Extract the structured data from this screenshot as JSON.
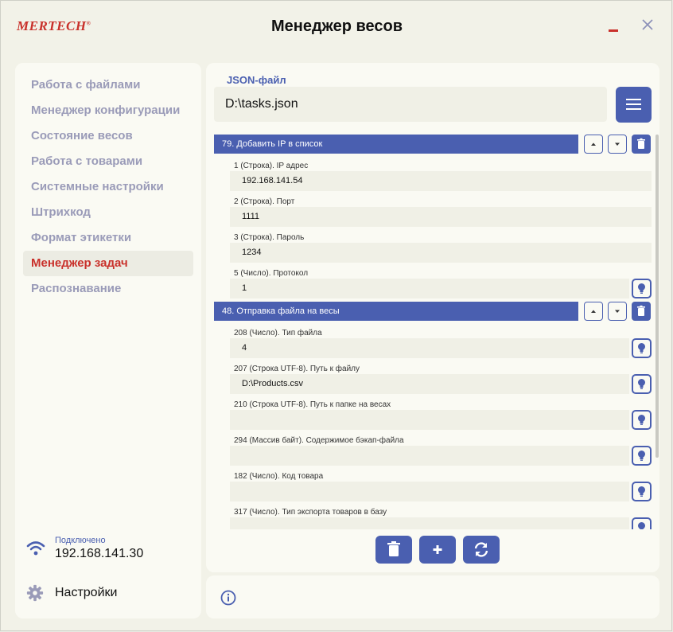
{
  "app": {
    "logo": "MERTECH",
    "title": "Менеджер весов"
  },
  "sidebar": {
    "items": [
      {
        "label": "Работа с файлами"
      },
      {
        "label": "Менеджер конфигурации"
      },
      {
        "label": "Состояние весов"
      },
      {
        "label": "Работа с товарами"
      },
      {
        "label": "Системные настройки"
      },
      {
        "label": "Штрихкод"
      },
      {
        "label": "Формат этикетки"
      },
      {
        "label": "Менеджер задач",
        "active": true
      },
      {
        "label": "Распознавание"
      }
    ],
    "connection": {
      "status": "Подключено",
      "ip": "192.168.141.30"
    },
    "settings_label": "Настройки"
  },
  "main": {
    "json_label": "JSON-файл",
    "file_path": "D:\\tasks.json",
    "tasks": [
      {
        "title": "79. Добавить IP в список",
        "fields": [
          {
            "label": "1 (Строка). IP адрес",
            "value": "192.168.141.54"
          },
          {
            "label": "2 (Строка). Порт",
            "value": "1111"
          },
          {
            "label": "3 (Строка). Пароль",
            "value": "1234"
          },
          {
            "label": "5 (Число). Протокол",
            "value": "1"
          }
        ]
      },
      {
        "title": "48. Отправка файла на весы",
        "fields": [
          {
            "label": "208 (Число). Тип файла",
            "value": "4"
          },
          {
            "label": "207 (Строка UTF-8). Путь к файлу",
            "value": "D:\\Products.csv"
          },
          {
            "label": "210 (Строка UTF-8). Путь к папке на весах",
            "value": ""
          },
          {
            "label": "294 (Массив байт). Содержимое бэкап-файла",
            "value": ""
          },
          {
            "label": "182 (Число). Код товара",
            "value": ""
          },
          {
            "label": "317 (Число). Тип экспорта товаров в базу",
            "value": ""
          }
        ]
      }
    ]
  },
  "colors": {
    "accent": "#4a5fb0",
    "brand": "#c9312b",
    "panel": "#fafaf3",
    "field": "#f0f0e6"
  }
}
